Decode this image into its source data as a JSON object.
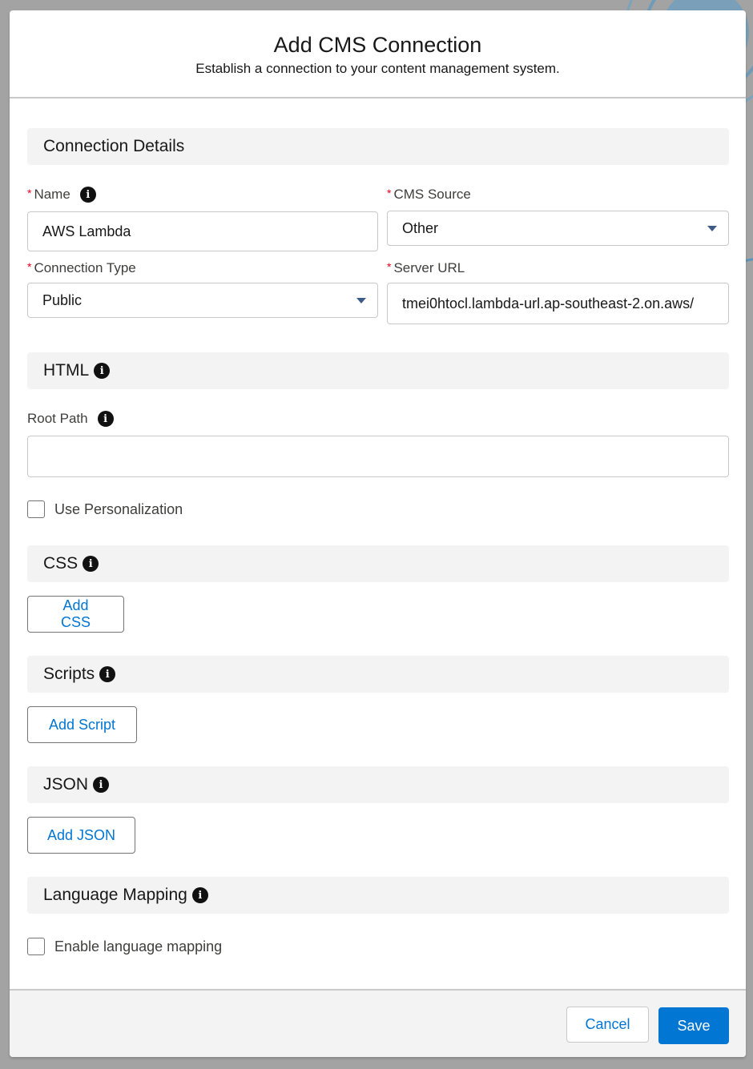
{
  "modal": {
    "title": "Add CMS Connection",
    "subtitle": "Establish a connection to your content management system."
  },
  "sections": {
    "connection_details": {
      "title": "Connection Details"
    },
    "html": {
      "title": "HTML"
    },
    "css": {
      "title": "CSS",
      "button_label": "Add CSS"
    },
    "scripts": {
      "title": "Scripts",
      "button_label": "Add Script"
    },
    "json": {
      "title": "JSON",
      "button_label": "Add JSON"
    },
    "language_mapping": {
      "title": "Language Mapping"
    }
  },
  "fields": {
    "name": {
      "label": "Name",
      "required": true,
      "value": "AWS Lambda"
    },
    "cms_source": {
      "label": "CMS Source",
      "required": true,
      "value": "Other"
    },
    "connection_type": {
      "label": "Connection Type",
      "required": true,
      "value": "Public"
    },
    "server_url": {
      "label": "Server URL",
      "required": true,
      "value": "tmei0htocl.lambda-url.ap-southeast-2.on.aws/"
    },
    "root_path": {
      "label": "Root Path",
      "value": "",
      "placeholder": ""
    },
    "use_personalization": {
      "label": "Use Personalization",
      "checked": false
    },
    "enable_language_mapping": {
      "label": "Enable language mapping",
      "checked": false
    }
  },
  "icons": {
    "info": "i",
    "required": "*"
  },
  "footer": {
    "cancel_label": "Cancel",
    "save_label": "Save"
  },
  "colors": {
    "brand": "#0176d3",
    "required": "#ea001e",
    "section_bg": "#f3f3f3",
    "overlay": "#a3a3a3"
  }
}
